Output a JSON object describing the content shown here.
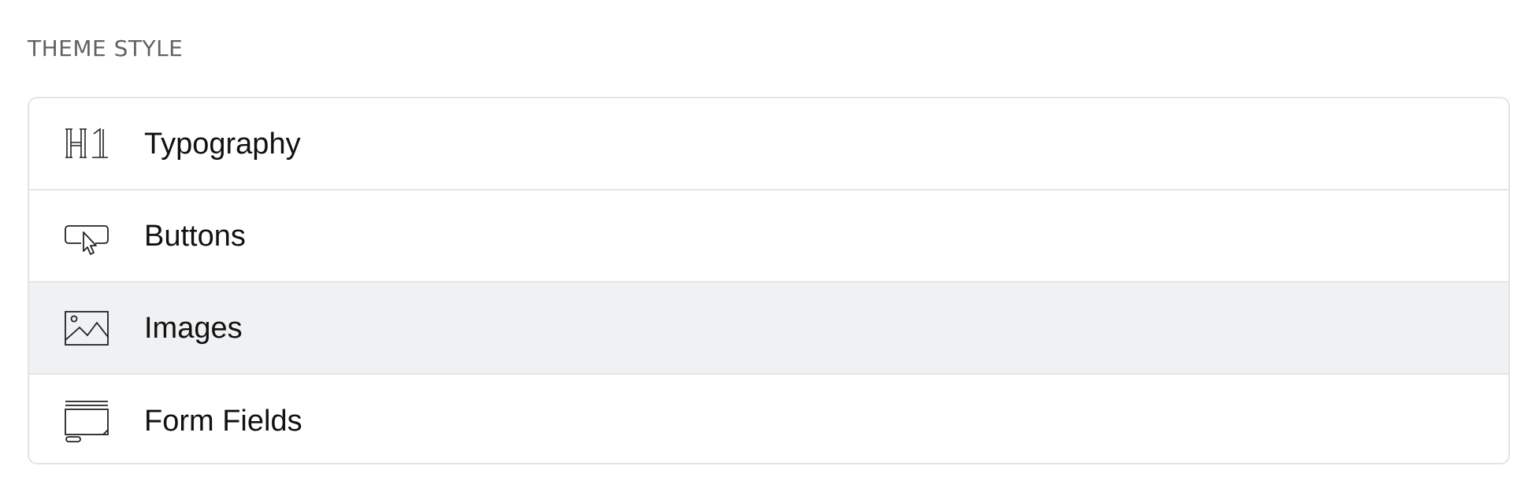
{
  "section": {
    "title": "THEME STYLE"
  },
  "items": [
    {
      "label": "Typography",
      "icon": "heading-h1-icon"
    },
    {
      "label": "Buttons",
      "icon": "button-cursor-icon"
    },
    {
      "label": "Images",
      "icon": "image-icon",
      "selected": true
    },
    {
      "label": "Form Fields",
      "icon": "form-field-icon"
    }
  ],
  "colors": {
    "title": "#5f6368",
    "border": "#e3e4e6",
    "selected_bg": "#f0f1f3",
    "label": "#111111"
  }
}
